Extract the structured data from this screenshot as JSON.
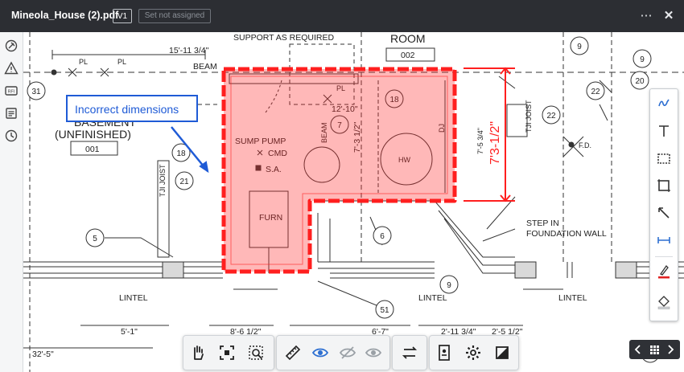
{
  "header": {
    "file_name": "Mineola_House (2).pdf",
    "version": "V1",
    "status": "Set not assigned",
    "more_label": "⋯",
    "close_label": "✕"
  },
  "markup": {
    "callout_text": "Incorrect dimensions",
    "dimension_text": "7'3-1/2\"",
    "cloud_color": "#ff1f1f",
    "callout_color": "#1f5bd6"
  },
  "drawing": {
    "labels": {
      "support": "SUPPORT AS REQUIRED",
      "room": "ROOM",
      "room_num": "002",
      "dim_top": "15'-11 3/4\"",
      "beam_top": "BEAM",
      "pl1": "PL",
      "pl2": "PL",
      "pl3": "PL",
      "basement": "BASEMENT",
      "unfinished": "(UNFINISHED)",
      "basement_num": "001",
      "tji_left": "TJI JOIST",
      "tji_right": "TJI JOIST",
      "beam_mid": "BEAM",
      "dim_12_10": "12'-10\"",
      "dim_7_3": "7'-3 1/2\"",
      "dim_7_5": "7'-5 3/4\"",
      "dj": "DJ",
      "sump": "SUMP PUMP",
      "cmd": "CMD",
      "sa": "S.A.",
      "hw": "HW",
      "furn": "FURN",
      "fd": "F.D.",
      "step_in": "STEP IN",
      "foundation": "FOUNDATION WALL",
      "lintel1": "LINTEL",
      "lintel2": "LINTEL",
      "lintel3": "LINTEL",
      "dim_5_1": "5'-1\"",
      "dim_8_6": "8'-6 1/2\"",
      "dim_6_7": "6'-7\"",
      "dim_2_11": "2'-11 3/4\"",
      "dim_2_5": "2'-5 1/2\"",
      "dim_32_5": "32'-5\""
    },
    "tags": [
      "9",
      "9",
      "31",
      "18",
      "7",
      "21",
      "18",
      "22",
      "22",
      "20",
      "5",
      "6",
      "51",
      "9",
      "4"
    ]
  },
  "toolbar": {
    "pan": "hand-icon",
    "fit": "fit-view-icon",
    "zoom_area": "zoom-area-icon",
    "measure": "ruler-icon",
    "markups_visible": "eye-icon",
    "hide": "eye-slash-icon",
    "hide_other": "eye-off-icon",
    "compare": "compare-icon",
    "properties": "properties-icon",
    "settings": "gear-icon",
    "fullscreen": "fullscreen-icon"
  }
}
